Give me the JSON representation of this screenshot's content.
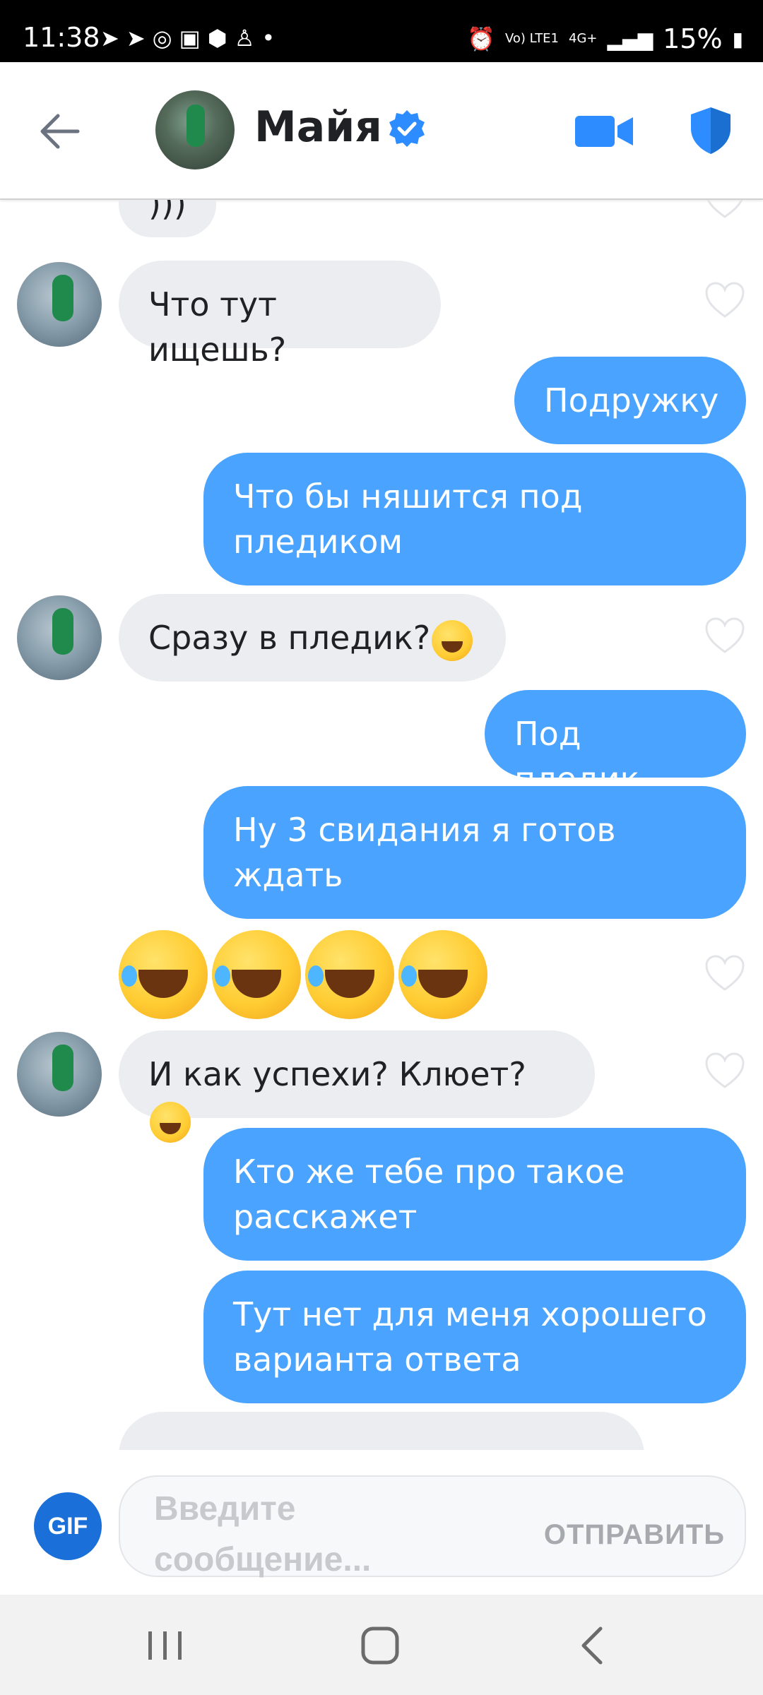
{
  "status_bar": {
    "time": "11:38",
    "network": "Vo) LTE1",
    "network_type": "4G+",
    "battery": "15%"
  },
  "header": {
    "contact_name": "Майя",
    "icons": [
      "back-arrow-icon",
      "verified-badge-icon",
      "video-call-icon",
      "shield-icon"
    ],
    "accent_color": "#2d8cff"
  },
  "messages": [
    {
      "side": "in",
      "text": ")))"
    },
    {
      "side": "in",
      "text": "Что тут ищешь?"
    },
    {
      "side": "out",
      "text": "Подружку"
    },
    {
      "side": "out",
      "line1": "Что бы няшится под",
      "line2": "пледиком"
    },
    {
      "side": "in",
      "text": "Сразу в пледик?",
      "emoji": "sweat-smile-emoji"
    },
    {
      "side": "out",
      "text": "Под пледик"
    },
    {
      "side": "out",
      "line1": "Ну 3 свидания я готов",
      "line2": "ждать"
    },
    {
      "side": "in",
      "emoji_only": [
        "rofl-emoji",
        "rofl-emoji",
        "rofl-emoji",
        "rofl-emoji"
      ]
    },
    {
      "side": "in",
      "text": "И как успехи? Клюет?",
      "emoji": "rofl-emoji"
    },
    {
      "side": "out",
      "line1": "Кто же тебе про такое",
      "line2": "расскажет"
    },
    {
      "side": "out",
      "line1": "Тут нет для меня хорошего",
      "line2": "варианта ответа"
    }
  ],
  "colors": {
    "outgoing_bubble": "#4aa3ff",
    "incoming_bubble": "#ebedf0"
  },
  "composer": {
    "gif_label": "GIF",
    "placeholder": "Введите сообщение...",
    "send_label": "ОТПРАВИТЬ"
  }
}
